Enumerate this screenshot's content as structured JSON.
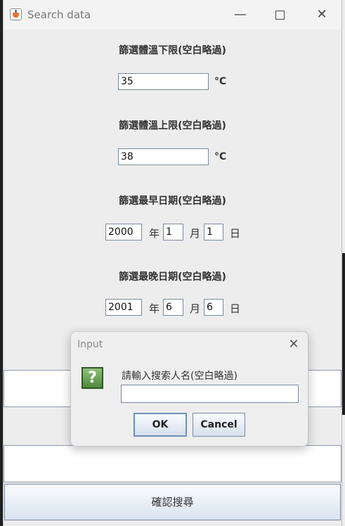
{
  "window": {
    "title": "Search data",
    "controls": {
      "minimize": "—",
      "maximize": "",
      "close": "✕"
    }
  },
  "form": {
    "temp_min": {
      "label": "篩選體溫下限(空白略過)",
      "value": "35",
      "unit": "°C"
    },
    "temp_max": {
      "label": "篩選體溫上限(空白略過)",
      "value": "38",
      "unit": "°C"
    },
    "date_earliest": {
      "label": "篩選最早日期(空白略過)",
      "year": "2000",
      "month": "1",
      "day": "1",
      "year_label": "年",
      "month_label": "月",
      "day_label": "日"
    },
    "date_latest": {
      "label": "篩選最晚日期(空白略過)",
      "year": "2001",
      "month": "6",
      "day": "6",
      "year_label": "年",
      "month_label": "月",
      "day_label": "日"
    },
    "confirm_label": "確認搜尋"
  },
  "dialog": {
    "title": "Input",
    "close": "✕",
    "icon": "?",
    "message": "請輸入搜索人名(空白略過)",
    "input_value": "",
    "ok_label": "OK",
    "cancel_label": "Cancel"
  },
  "icons": {
    "app": "java-app-icon",
    "question": "question-icon"
  }
}
